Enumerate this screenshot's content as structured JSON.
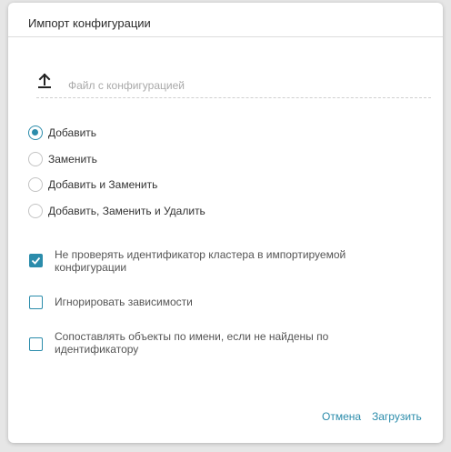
{
  "dialog": {
    "title": "Импорт конфигурации",
    "file": {
      "placeholder": "Файл с конфигурацией",
      "icon": "upload-icon"
    },
    "radios": [
      {
        "label": "Добавить",
        "checked": true
      },
      {
        "label": "Заменить",
        "checked": false
      },
      {
        "label": "Добавить и Заменить",
        "checked": false
      },
      {
        "label": "Добавить, Заменить и Удалить",
        "checked": false
      }
    ],
    "checkboxes": [
      {
        "label": "Не проверять идентификатор кластера в импортируемой конфигурации",
        "checked": true
      },
      {
        "label": "Игнорировать зависимости",
        "checked": false
      },
      {
        "label": "Сопоставлять объекты по имени, если не найдены по идентификатору",
        "checked": false
      }
    ],
    "buttons": {
      "cancel": "Отмена",
      "upload": "Загрузить"
    }
  },
  "colors": {
    "accent": "#2b8cab",
    "background": "#e6e6e6"
  }
}
